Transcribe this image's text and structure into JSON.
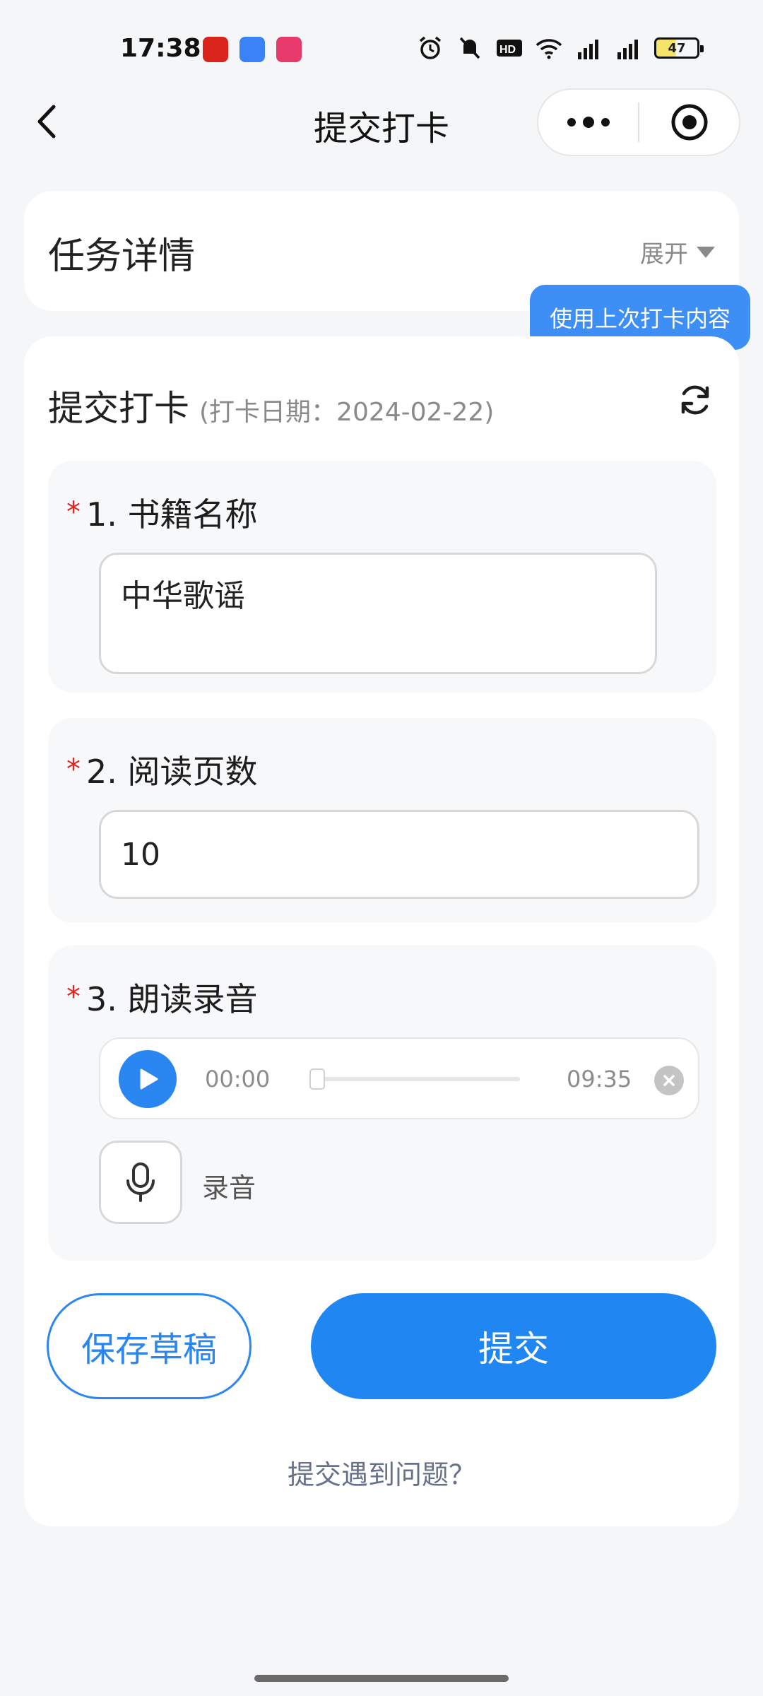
{
  "status_bar": {
    "time": "17:38",
    "battery": "47",
    "colors": {
      "battery_fill": "#f6e36a"
    },
    "icons": [
      "alarm-icon",
      "mute-icon",
      "hd-icon",
      "wifi-icon",
      "signal-5g-icon",
      "signal-5g-icon"
    ]
  },
  "navbar": {
    "title": "提交打卡"
  },
  "task_card": {
    "title": "任务详情",
    "expand_label": "展开"
  },
  "submit_section": {
    "title": "提交打卡",
    "date_label": "(打卡日期：2024-02-22)",
    "tooltip": "使用上次打卡内容"
  },
  "questions": [
    {
      "required_mark": "*",
      "label": "1. 书籍名称",
      "value": "中华歌谣"
    },
    {
      "required_mark": "*",
      "label": "2. 阅读页数",
      "value": "10"
    },
    {
      "required_mark": "*",
      "label": "3. 朗读录音",
      "current_time": "00:00",
      "total_time": "09:35",
      "record_label": "录音",
      "progress": 0
    }
  ],
  "actions": {
    "save_draft": "保存草稿",
    "submit": "提交",
    "help": "提交遇到问题？"
  },
  "colors": {
    "primary": "#1f86f2",
    "required": "#e02424",
    "tooltip": "#3d8ef5"
  }
}
